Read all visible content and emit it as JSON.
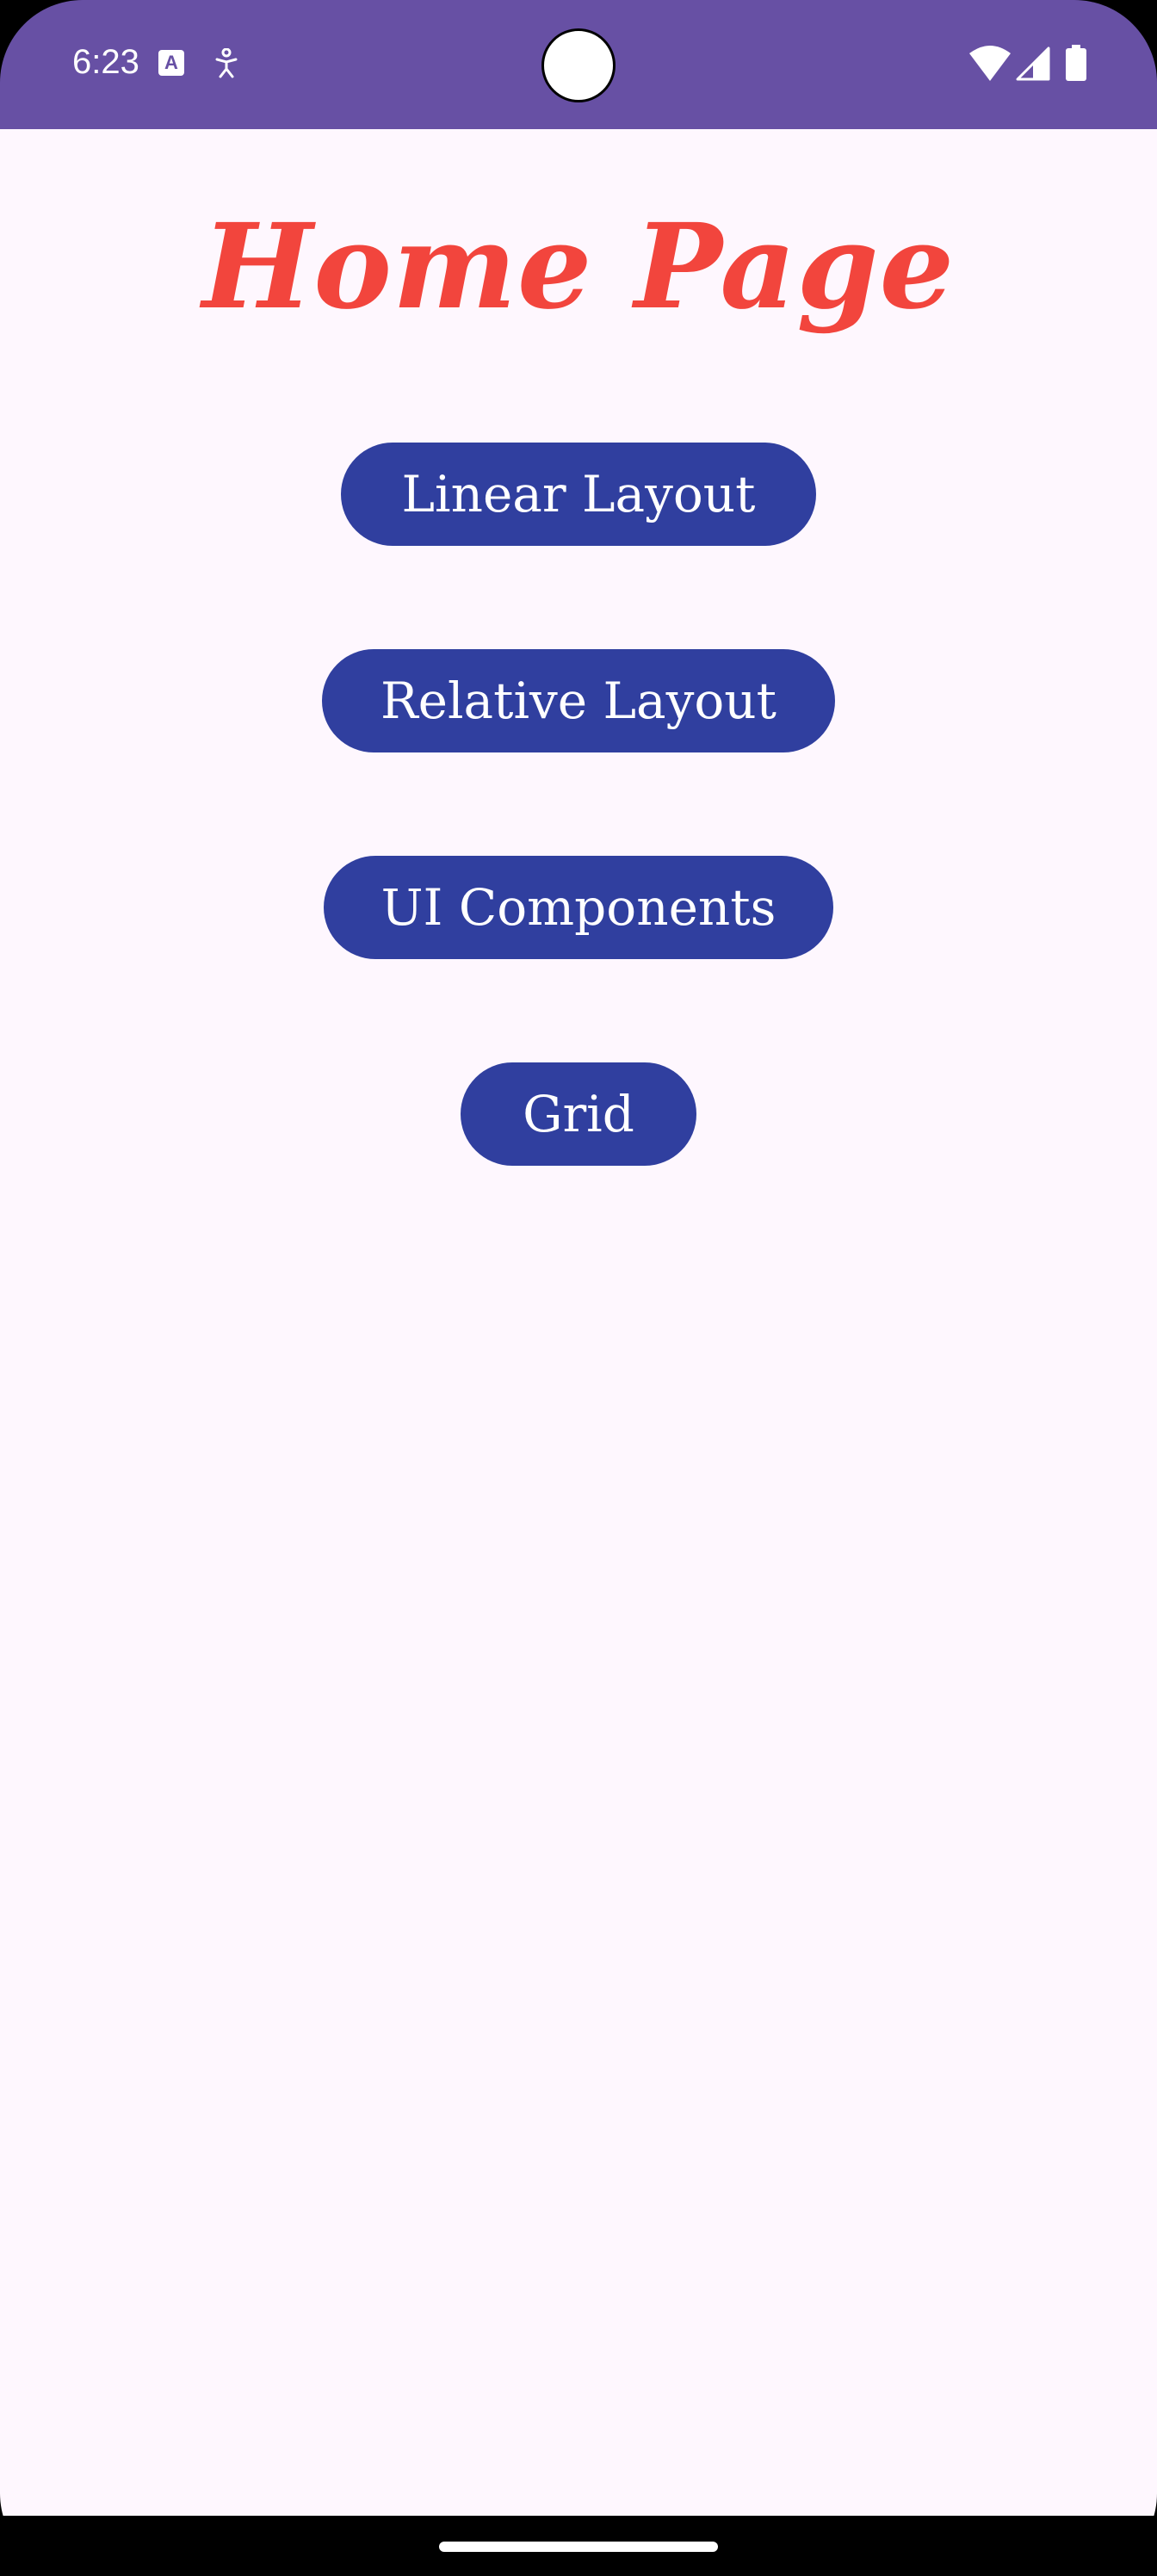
{
  "status_bar": {
    "time": "6:23",
    "background_color": "#6750A4",
    "icons": [
      "text-a-icon",
      "accessibility-icon",
      "wifi-icon",
      "cellular-signal-icon",
      "battery-icon"
    ]
  },
  "page": {
    "title": "Home Page",
    "title_color": "#F2453D",
    "background_color": "#FEF7FE"
  },
  "buttons": {
    "linear_layout": "Linear Layout",
    "relative_layout": "Relative Layout",
    "ui_components": "UI Components",
    "grid": "Grid",
    "background_color": "#303F9F",
    "text_color": "#FFFFFF"
  }
}
